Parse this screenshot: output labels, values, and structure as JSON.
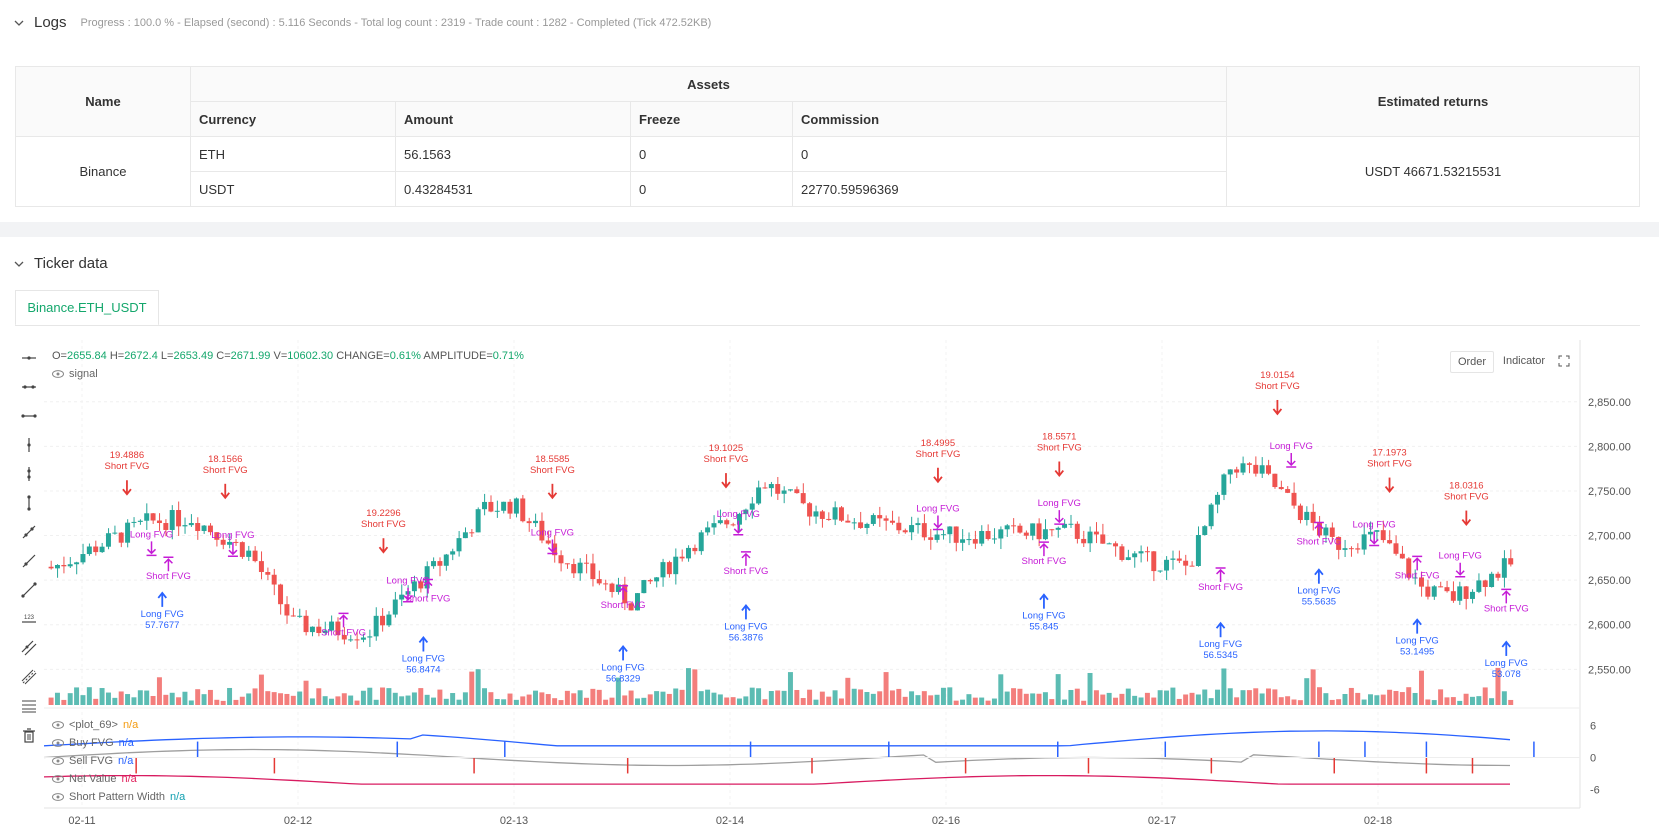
{
  "logs": {
    "title": "Logs",
    "progress": "Progress : 100.0 % - Elapsed (second) : 5.116  Seconds - Total log count : 2319 - Trade count : 1282 - Completed (Tick 472.52KB)"
  },
  "assets_table": {
    "name_header": "Name",
    "assets_header": "Assets",
    "returns_header": "Estimated returns",
    "columns": [
      "Currency",
      "Amount",
      "Freeze",
      "Commission"
    ],
    "exchange": "Binance",
    "rows": [
      {
        "currency": "ETH",
        "amount": "56.1563",
        "freeze": "0",
        "commission": "0"
      },
      {
        "currency": "USDT",
        "amount": "0.43284531",
        "freeze": "0",
        "commission": "22770.59596369"
      }
    ],
    "estimated_returns": "USDT 46671.53215531"
  },
  "ticker": {
    "title": "Ticker data",
    "tab": "Binance.ETH_USDT"
  },
  "ohlc": {
    "o_label": "O=",
    "o": "2655.84",
    "h_label": "H=",
    "h": "2672.4",
    "l_label": "L=",
    "l": "2653.49",
    "c_label": "C=",
    "c": "2671.99",
    "v_label": "V=",
    "v": "10602.30",
    "change_label": "CHANGE=",
    "change": "0.61%",
    "amp_label": "AMPLITUDE=",
    "amp": "0.71%"
  },
  "chart_buttons": {
    "order": "Order",
    "indicator": "Indicator"
  },
  "legend": {
    "signal": "signal",
    "plot69": "<plot_69>",
    "plot69_val": "n/a",
    "buy": "Buy FVG",
    "buy_val": "n/a",
    "sell": "Sell FVG",
    "sell_val": "n/a",
    "net": "Net Value",
    "net_val": "n/a",
    "short_width": "Short Pattern Width",
    "short_width_val": "n/a"
  },
  "colors": {
    "up": "#26a69a",
    "down": "#ef5350",
    "buy_arrow": "#2962ff",
    "sell_arrow": "#e53935",
    "magenta": "#c51cd6",
    "accent": "#14a76c"
  },
  "chart_data": {
    "type": "candlestick",
    "x_ticks": [
      "02-11",
      "02-12",
      "02-13",
      "02-14",
      "02-16",
      "02-17",
      "02-18"
    ],
    "y_ticks": [
      "2,850.00",
      "2,800.00",
      "2,750.00",
      "2,700.00",
      "2,650.00",
      "2,600.00",
      "2,550.00"
    ],
    "ylim": [
      2510,
      2880
    ],
    "indicator_ticks": [
      "6",
      "0",
      "-6"
    ],
    "indicator_ylim": [
      -8,
      8
    ],
    "short_signals": [
      {
        "x": 0.054,
        "value": "19.4886",
        "label": "Short FVG",
        "price": 2762
      },
      {
        "x": 0.118,
        "value": "18.1566",
        "label": "Short FVG",
        "price": 2758
      },
      {
        "x": 0.221,
        "value": "19.2296",
        "label": "Short FVG",
        "price": 2697
      },
      {
        "x": 0.331,
        "value": "18.5585",
        "label": "Short FVG",
        "price": 2758
      },
      {
        "x": 0.444,
        "value": "19.1025",
        "label": "Short FVG",
        "price": 2770
      },
      {
        "x": 0.582,
        "value": "18.4995",
        "label": "Short FVG",
        "price": 2776
      },
      {
        "x": 0.661,
        "value": "18.5571",
        "label": "Short FVG",
        "price": 2783
      },
      {
        "x": 0.803,
        "value": "19.0154",
        "label": "Short FVG",
        "price": 2852
      },
      {
        "x": 0.876,
        "value": "17.1973",
        "label": "Short FVG",
        "price": 2765
      },
      {
        "x": 0.926,
        "value": "18.0316",
        "label": "Short FVG",
        "price": 2728
      }
    ],
    "long_signals": [
      {
        "x": 0.077,
        "value": "57.7677",
        "label": "Long FVG",
        "price": 2620
      },
      {
        "x": 0.247,
        "value": "56.8474",
        "label": "Long FVG",
        "price": 2570
      },
      {
        "x": 0.377,
        "value": "56.8329",
        "label": "Long FVG",
        "price": 2560
      },
      {
        "x": 0.457,
        "value": "56.3876",
        "label": "Long FVG",
        "price": 2606
      },
      {
        "x": 0.651,
        "value": "55.845",
        "label": "Long FVG",
        "price": 2618
      },
      {
        "x": 0.766,
        "value": "56.5345",
        "label": "Long FVG",
        "price": 2586
      },
      {
        "x": 0.83,
        "value": "55.5635",
        "label": "Long FVG",
        "price": 2646
      },
      {
        "x": 0.894,
        "value": "53.1495",
        "label": "Long FVG",
        "price": 2590
      },
      {
        "x": 0.952,
        "value": "53.078",
        "label": "Long FVG",
        "price": 2565
      }
    ],
    "pattern_labels_long": [
      {
        "x": 0.07,
        "price": 2698,
        "label": "Long FVG"
      },
      {
        "x": 0.123,
        "price": 2697,
        "label": "Long FVG"
      },
      {
        "x": 0.237,
        "price": 2646,
        "label": "Long FVG"
      },
      {
        "x": 0.331,
        "price": 2700,
        "label": "Long FVG"
      },
      {
        "x": 0.452,
        "price": 2721,
        "label": "Long FVG"
      },
      {
        "x": 0.582,
        "price": 2727,
        "label": "Long FVG"
      },
      {
        "x": 0.661,
        "price": 2733,
        "label": "Long FVG"
      },
      {
        "x": 0.812,
        "price": 2797,
        "label": "Long FVG"
      },
      {
        "x": 0.866,
        "price": 2709,
        "label": "Long FVG"
      },
      {
        "x": 0.922,
        "price": 2674,
        "label": "Long FVG"
      }
    ],
    "pattern_labels_short": [
      {
        "x": 0.081,
        "price": 2651,
        "label": "Short FVG"
      },
      {
        "x": 0.195,
        "price": 2588,
        "label": "Short FVG"
      },
      {
        "x": 0.25,
        "price": 2626,
        "label": "Short FVG"
      },
      {
        "x": 0.377,
        "price": 2619,
        "label": "Short FVG"
      },
      {
        "x": 0.457,
        "price": 2657,
        "label": "Short FVG"
      },
      {
        "x": 0.651,
        "price": 2668,
        "label": "Short FVG"
      },
      {
        "x": 0.766,
        "price": 2639,
        "label": "Short FVG"
      },
      {
        "x": 0.83,
        "price": 2690,
        "label": "Short FVG"
      },
      {
        "x": 0.894,
        "price": 2652,
        "label": "Short FVG"
      },
      {
        "x": 0.952,
        "price": 2615,
        "label": "Short FVG"
      }
    ]
  }
}
